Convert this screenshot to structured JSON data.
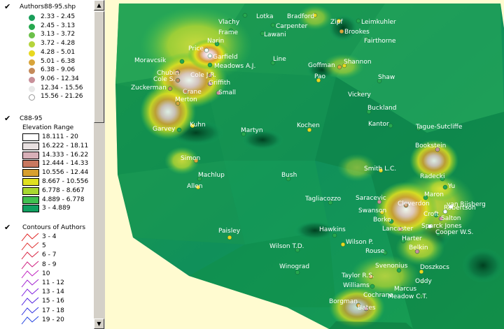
{
  "legend": {
    "authors_layer": {
      "title": "Authors88-95.shp",
      "items": [
        {
          "label": "2.33 - 2.45",
          "color": "#1a9e5a"
        },
        {
          "label": "2.45 - 3.13",
          "color": "#27a84f"
        },
        {
          "label": "3.13 - 3.72",
          "color": "#6cc04a"
        },
        {
          "label": "3.72 - 4.28",
          "color": "#b5d43c"
        },
        {
          "label": "4.28 - 5.01",
          "color": "#e8d820"
        },
        {
          "label": "5.01 - 6.38",
          "color": "#d8a43a"
        },
        {
          "label": "6.38 - 9.06",
          "color": "#c48a5a"
        },
        {
          "label": "9.06 - 12.34",
          "color": "#c8909a"
        },
        {
          "label": "12.34 - 15.56",
          "color": "#e8e8e8"
        },
        {
          "label": "15.56 - 21.26",
          "color": "#ffffff"
        }
      ]
    },
    "elevation_layer": {
      "title": "C88-95",
      "subtitle": "Elevation Range",
      "items": [
        {
          "label": "18.111 - 20",
          "color": "#ffffff"
        },
        {
          "label": "16.222 - 18.11",
          "color": "#e8e0e0"
        },
        {
          "label": "14.333 - 16.22",
          "color": "#d8b0b8"
        },
        {
          "label": "12.444 - 14.33",
          "color": "#c87860"
        },
        {
          "label": "10.556 - 12.44",
          "color": "#d8a030"
        },
        {
          "label": "8.667 - 10.556",
          "color": "#e0e020"
        },
        {
          "label": "6.778 - 8.667",
          "color": "#a8d830"
        },
        {
          "label": "4.889 - 6.778",
          "color": "#40c050"
        },
        {
          "label": "3 - 4.889",
          "color": "#10a060"
        }
      ]
    },
    "contours_layer": {
      "title": "Contours of Authors",
      "items": [
        {
          "label": "3 - 4",
          "color": "#e02020"
        },
        {
          "label": "5",
          "color": "#e03030"
        },
        {
          "label": "6 - 7",
          "color": "#d82040"
        },
        {
          "label": "8 - 9",
          "color": "#d02080"
        },
        {
          "label": "10",
          "color": "#c020c0"
        },
        {
          "label": "11 - 12",
          "color": "#a020d0"
        },
        {
          "label": "13 - 14",
          "color": "#8020e0"
        },
        {
          "label": "15 - 16",
          "color": "#5020e0"
        },
        {
          "label": "17 - 18",
          "color": "#3030e0"
        },
        {
          "label": "19 - 20",
          "color": "#2040e0"
        }
      ]
    }
  },
  "map": {
    "authors": [
      {
        "name": "Lotka",
        "dot": "#27a84f"
      },
      {
        "name": "Bradford",
        "dot": "#e8d820"
      },
      {
        "name": "Zipf",
        "dot": "#e8d820"
      },
      {
        "name": "Leimkuhler",
        "dot": "#27a84f"
      },
      {
        "name": "Vlachy",
        "dot": "#27a84f"
      },
      {
        "name": "Carpenter",
        "dot": "#27a84f"
      },
      {
        "name": "Frame",
        "dot": "#27a84f"
      },
      {
        "name": "Lawani",
        "dot": "#27a84f"
      },
      {
        "name": "Brookes",
        "dot": "#d8a43a"
      },
      {
        "name": "Fairthorne",
        "dot": "#27a84f"
      },
      {
        "name": "Narin",
        "dot": "#27a84f"
      },
      {
        "name": "Price",
        "dot": "#ffffff"
      },
      {
        "name": "Garfield",
        "dot": "#ffffff"
      },
      {
        "name": "Moravcsik",
        "dot": "#27a84f"
      },
      {
        "name": "Meadows A.J.",
        "dot": "#27a84f"
      },
      {
        "name": "Line",
        "dot": "#27a84f"
      },
      {
        "name": "Goffman",
        "dot": "#d8a43a"
      },
      {
        "name": "Shannon",
        "dot": "#e8d820"
      },
      {
        "name": "Chubin",
        "dot": "#c48a5a"
      },
      {
        "name": "Cole J.R.",
        "dot": "#c48a5a"
      },
      {
        "name": "Cole S.",
        "dot": "#c48a5a"
      },
      {
        "name": "Griffith",
        "dot": "#c8909a"
      },
      {
        "name": "Zuckerman",
        "dot": "#c48a5a"
      },
      {
        "name": "Crane",
        "dot": "#c48a5a"
      },
      {
        "name": "Small",
        "dot": "#c8909a"
      },
      {
        "name": "Pao",
        "dot": "#e8d820"
      },
      {
        "name": "Shaw",
        "dot": "#27a84f"
      },
      {
        "name": "Vickery",
        "dot": "#27a84f"
      },
      {
        "name": "Merton",
        "dot": "#d8a43a"
      },
      {
        "name": "Buckland",
        "dot": "#27a84f"
      },
      {
        "name": "Kuhn",
        "dot": "#e8d820"
      },
      {
        "name": "Garvey",
        "dot": "#27a84f"
      },
      {
        "name": "Kochen",
        "dot": "#e8d820"
      },
      {
        "name": "Kantor",
        "dot": "#27a84f"
      },
      {
        "name": "Tague-Sutcliffe",
        "dot": "#27a84f"
      },
      {
        "name": "Martyn",
        "dot": "#27a84f"
      },
      {
        "name": "Bookstein",
        "dot": "#c8909a"
      },
      {
        "name": "Simon",
        "dot": "#d8a43a"
      },
      {
        "name": "Smith L.C.",
        "dot": "#e8d820"
      },
      {
        "name": "Machlup",
        "dot": "#27a84f"
      },
      {
        "name": "Bush",
        "dot": "#27a84f"
      },
      {
        "name": "Radecki",
        "dot": "#27a84f"
      },
      {
        "name": "Allen",
        "dot": "#e8d820"
      },
      {
        "name": "Yu",
        "dot": "#27a84f"
      },
      {
        "name": "Saracevic",
        "dot": "#c8909a"
      },
      {
        "name": "Maron",
        "dot": "#27a84f"
      },
      {
        "name": "Tagliacozzo",
        "dot": "#27a84f"
      },
      {
        "name": "Cleverdon",
        "dot": "#c48a5a"
      },
      {
        "name": "van Rijsberg",
        "dot": "#ffffff"
      },
      {
        "name": "Swanson",
        "dot": "#e8d820"
      },
      {
        "name": "Croft",
        "dot": "#27a84f"
      },
      {
        "name": "Robertson",
        "dot": "#ffffff"
      },
      {
        "name": "Salton",
        "dot": "#c8909a"
      },
      {
        "name": "Borko",
        "dot": "#27a84f"
      },
      {
        "name": "Sparck Jones",
        "dot": "#ffffff"
      },
      {
        "name": "Lancaster",
        "dot": "#c48a5a"
      },
      {
        "name": "Cooper W.S.",
        "dot": "#27a84f"
      },
      {
        "name": "Paisley",
        "dot": "#e8d820"
      },
      {
        "name": "Hawkins",
        "dot": "#27a84f"
      },
      {
        "name": "Harter",
        "dot": "#27a84f"
      },
      {
        "name": "Wilson P.",
        "dot": "#e8d820"
      },
      {
        "name": "Wilson T.D.",
        "dot": "#27a84f"
      },
      {
        "name": "Rouse",
        "dot": "#27a84f"
      },
      {
        "name": "Belkin",
        "dot": "#c8909a"
      },
      {
        "name": "Winograd",
        "dot": "#27a84f"
      },
      {
        "name": "Svenonius",
        "dot": "#27a84f"
      },
      {
        "name": "Doszkocs",
        "dot": "#e8d820"
      },
      {
        "name": "Taylor R.S.",
        "dot": "#d8a43a"
      },
      {
        "name": "Oddy",
        "dot": "#27a84f"
      },
      {
        "name": "Williams",
        "dot": "#27a84f"
      },
      {
        "name": "Marcus",
        "dot": "#27a84f"
      },
      {
        "name": "Cochrane",
        "dot": "#27a84f"
      },
      {
        "name": "Meadow C.T.",
        "dot": "#27a84f"
      },
      {
        "name": "Borgman",
        "dot": "#d8a43a"
      },
      {
        "name": "Bates",
        "dot": "#c8909a"
      }
    ]
  }
}
